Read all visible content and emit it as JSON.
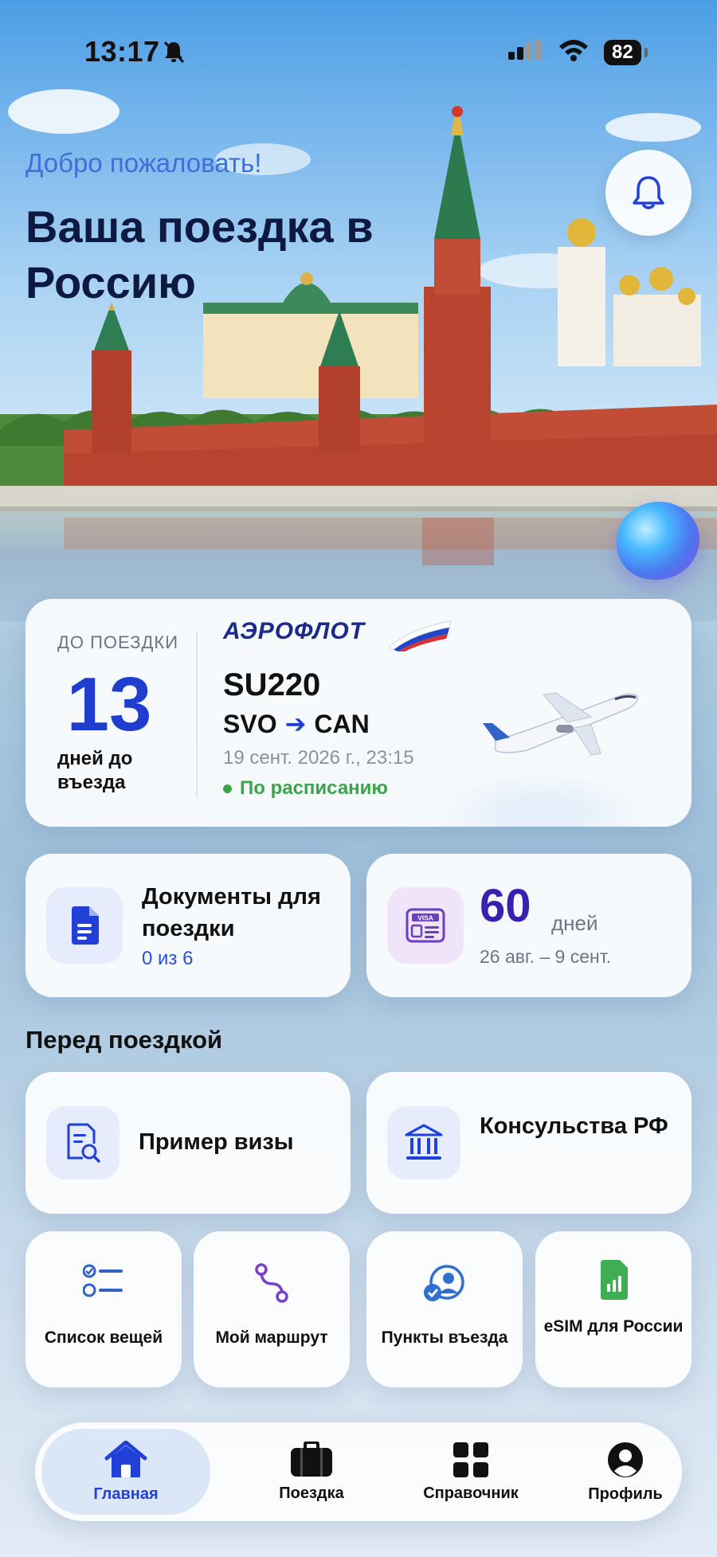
{
  "status_bar": {
    "time": "13:17",
    "battery": "82"
  },
  "header": {
    "welcome": "Добро пожаловать!",
    "title": "Ваша поездка в Россию"
  },
  "trip": {
    "until_label": "ДО ПОЕЗДКИ",
    "days": "13",
    "days_label": "дней до въезда",
    "airline": "АЭРОФЛОТ",
    "flight": "SU220",
    "from": "SVO",
    "to": "CAN",
    "datetime": "19 сент. 2026 г., 23:15",
    "status": "По расписанию"
  },
  "documents": {
    "title": "Документы для поездки",
    "progress": "0 из 6"
  },
  "visa": {
    "days": "60",
    "unit": "дней",
    "range": "26 авг. – 9 сент.",
    "badge": "VISA"
  },
  "before_trip": {
    "title": "Перед поездкой",
    "visa_sample": "Пример визы",
    "consulates": "Консульства РФ",
    "items": [
      {
        "label": "Список вещей"
      },
      {
        "label": "Мой маршрут"
      },
      {
        "label": "Пункты въезда"
      },
      {
        "label": "eSIM для России"
      }
    ]
  },
  "tabs": [
    {
      "label": "Главная"
    },
    {
      "label": "Поездка"
    },
    {
      "label": "Справочник"
    },
    {
      "label": "Профиль"
    }
  ],
  "colors": {
    "accent": "#1f3ed0",
    "green": "#3ba54a",
    "purple": "#3b1fb0"
  }
}
